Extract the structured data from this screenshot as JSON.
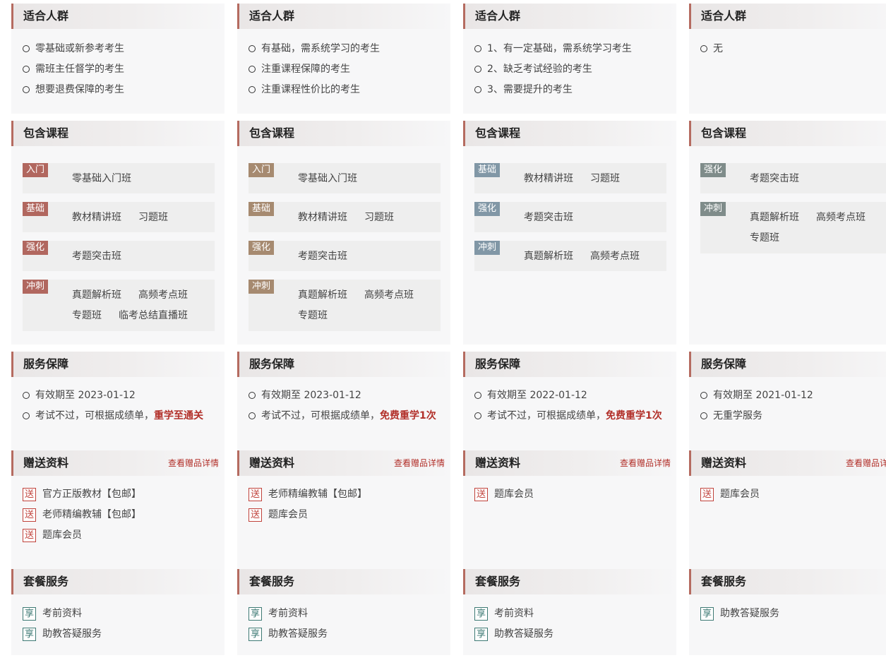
{
  "columns": [
    {
      "audience_title": "适合人群",
      "audience": [
        "零基础或新参考考生",
        "需班主任督学的考生",
        "想要退费保障的考生"
      ],
      "courses_title": "包含课程",
      "course_rows": [
        {
          "badge": "入门",
          "color": "#b1675f",
          "courses": [
            "零基础入门班"
          ]
        },
        {
          "badge": "基础",
          "color": "#b1675f",
          "courses": [
            "教材精讲班",
            "习题班"
          ]
        },
        {
          "badge": "强化",
          "color": "#b1675f",
          "courses": [
            "考题突击班"
          ]
        },
        {
          "badge": "冲刺",
          "color": "#b1675f",
          "courses": [
            "真题解析班",
            "高频考点班",
            "专题班",
            "临考总结直播班"
          ]
        }
      ],
      "service_title": "服务保障",
      "validity": "有效期至 2023-01-12",
      "retake_prefix": "考试不过，可根据成绩单，",
      "retake_highlight": "重学至通关",
      "gifts_title": "赠送资料",
      "gifts_link": "查看赠品详情",
      "gift_icon": "送",
      "gifts": [
        "官方正版教材【包邮】",
        "老师精编教辅【包邮】",
        "题库会员"
      ],
      "package_title": "套餐服务",
      "share_icon": "享",
      "package": [
        "考前资料",
        "助教答疑服务"
      ]
    },
    {
      "audience_title": "适合人群",
      "audience": [
        "有基础，需系统学习的考生",
        "注重课程保障的考生",
        "注重课程性价比的考生"
      ],
      "courses_title": "包含课程",
      "course_rows": [
        {
          "badge": "入门",
          "color": "#a68a70",
          "courses": [
            "零基础入门班"
          ]
        },
        {
          "badge": "基础",
          "color": "#a68a70",
          "courses": [
            "教材精讲班",
            "习题班"
          ]
        },
        {
          "badge": "强化",
          "color": "#a68a70",
          "courses": [
            "考题突击班"
          ]
        },
        {
          "badge": "冲刺",
          "color": "#a68a70",
          "courses": [
            "真题解析班",
            "高频考点班",
            "专题班"
          ]
        }
      ],
      "service_title": "服务保障",
      "validity": "有效期至 2023-01-12",
      "retake_prefix": "考试不过，可根据成绩单，",
      "retake_highlight": "免费重学1次",
      "gifts_title": "赠送资料",
      "gifts_link": "查看赠品详情",
      "gift_icon": "送",
      "gifts": [
        "老师精编教辅【包邮】",
        "题库会员"
      ],
      "package_title": "套餐服务",
      "share_icon": "享",
      "package": [
        "考前资料",
        "助教答疑服务"
      ]
    },
    {
      "audience_title": "适合人群",
      "audience": [
        "1、有一定基础，需系统学习考生",
        "2、缺乏考试经验的考生",
        "3、需要提升的考生"
      ],
      "courses_title": "包含课程",
      "course_rows": [
        {
          "badge": "基础",
          "color": "#8197a6",
          "courses": [
            "教材精讲班",
            "习题班"
          ]
        },
        {
          "badge": "强化",
          "color": "#8197a6",
          "courses": [
            "考题突击班"
          ]
        },
        {
          "badge": "冲刺",
          "color": "#8197a6",
          "courses": [
            "真题解析班",
            "高频考点班"
          ]
        }
      ],
      "service_title": "服务保障",
      "validity": "有效期至 2022-01-12",
      "retake_prefix": "考试不过，可根据成绩单，",
      "retake_highlight": "免费重学1次",
      "gifts_title": "赠送资料",
      "gifts_link": "查看赠品详情",
      "gift_icon": "送",
      "gifts": [
        "题库会员"
      ],
      "package_title": "套餐服务",
      "share_icon": "享",
      "package": [
        "考前资料",
        "助教答疑服务"
      ]
    },
    {
      "audience_title": "适合人群",
      "audience": [
        "无"
      ],
      "courses_title": "包含课程",
      "course_rows": [
        {
          "badge": "强化",
          "color": "#7f8c8a",
          "courses": [
            "考题突击班"
          ]
        },
        {
          "badge": "冲刺",
          "color": "#7f8c8a",
          "courses": [
            "真题解析班",
            "高频考点班",
            "专题班"
          ]
        }
      ],
      "service_title": "服务保障",
      "validity": "有效期至 2021-01-12",
      "retake_prefix": "无重学服务",
      "retake_highlight": "",
      "gifts_title": "赠送资料",
      "gifts_link": "查看赠品详情",
      "gift_icon": "送",
      "gifts": [
        "题库会员"
      ],
      "package_title": "套餐服务",
      "share_icon": "享",
      "package": [
        "助教答疑服务"
      ]
    }
  ]
}
